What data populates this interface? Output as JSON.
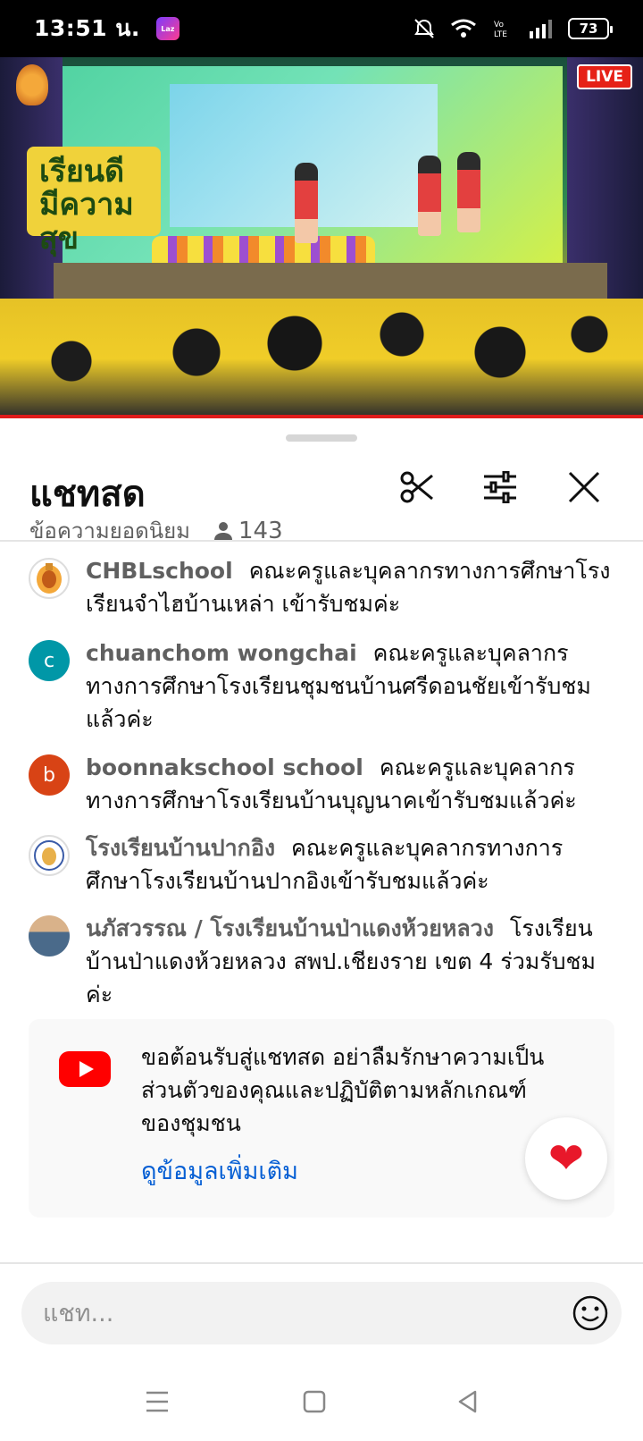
{
  "status_bar": {
    "time": "13:51 น.",
    "app_badge": "Laz",
    "battery": "73"
  },
  "video": {
    "live_label": "LIVE",
    "stage_sign": "เรียนดี มีความสุข"
  },
  "chat": {
    "title": "แชทสด",
    "filter_label": "ข้อความยอดนิยม",
    "viewer_count": "143",
    "messages": [
      {
        "author": "CHBLschool",
        "text": "คณะครูและบุคลากรทางการศึกษาโรงเรียนจำไฮบ้านเหล่า เข้ารับชมค่ะ",
        "avatar": "school-logo",
        "avatar_color": "#f4a83a"
      },
      {
        "author": "chuanchom wongchai",
        "text": "คณะครูและบุคลากรทางการศึกษาโรงเรียนชุมชนบ้านศรีดอนชัยเข้ารับชมแล้วค่ะ",
        "avatar_letter": "c",
        "avatar_color": "#0097a7"
      },
      {
        "author": "boonnakschool school",
        "text": "คณะครูและบุคลากรทางการศึกษาโรงเรียนบ้านบุญนาคเข้ารับชมแล้วค่ะ",
        "avatar_letter": "b",
        "avatar_color": "#d84315"
      },
      {
        "author": "โรงเรียนบ้านปากอิง",
        "text": "คณะครูและบุคลากรทางการศึกษาโรงเรียนบ้านปากอิงเข้ารับชมแล้วค่ะ",
        "avatar": "school-logo",
        "avatar_color": "#e8b04a"
      },
      {
        "author": "นภัสวรรณ / โรงเรียนบ้านป่าแดงห้วยหลวง",
        "text": "โรงเรียนบ้านป่าแดงห้วยหลวง สพป.เชียงราย เขต 4 ร่วมรับชมค่ะ",
        "avatar": "photo",
        "avatar_color": "#4a6a8a"
      }
    ],
    "welcome": {
      "text": "ขอต้อนรับสู่แชทสด อย่าลืมรักษาความเป็นส่วนตัวของคุณและปฏิบัติตามหลักเกณฑ์ของชุมชน",
      "more_link": "ดูข้อมูลเพิ่มเติม"
    },
    "input_placeholder": "แชท..."
  },
  "icons": {
    "clip": "scissors-icon",
    "settings": "tune-icon",
    "close": "close-icon",
    "heart": "heart-icon",
    "emoji": "emoji-icon"
  },
  "colors": {
    "live_red": "#e62117",
    "link_blue": "#065fd4",
    "heart_red": "#e8182a",
    "youtube_red": "#ff0000"
  }
}
